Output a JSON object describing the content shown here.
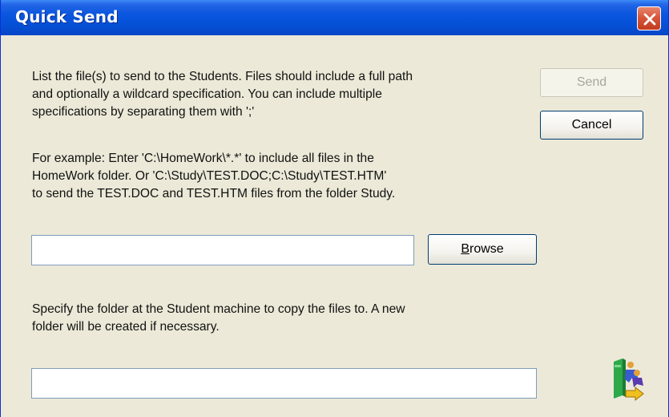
{
  "window": {
    "title": "Quick Send"
  },
  "instructions": {
    "lines": [
      "List the file(s) to send to the Students. Files should include a full path",
      "and optionally a wildcard specification. You can include multiple",
      "specifications by separating them with ';'"
    ]
  },
  "example": {
    "lines": [
      "For example: Enter 'C:\\HomeWork\\*.*' to include all files in the",
      "HomeWork folder. Or 'C:\\Study\\TEST.DOC;C:\\Study\\TEST.HTM'",
      "to send the TEST.DOC and TEST.HTM files from the folder Study."
    ]
  },
  "files_input": {
    "value": ""
  },
  "browse_button": {
    "label_prefix": "",
    "label_accel": "B",
    "label_rest": "rowse"
  },
  "send_button": {
    "label": "Send",
    "enabled": false
  },
  "cancel_button": {
    "label": "Cancel"
  },
  "folder_instructions": {
    "lines": [
      "Specify the folder at the Student machine to copy the files to. A new",
      "folder will be created if necessary."
    ]
  },
  "folder_input": {
    "value": ""
  },
  "icons": {
    "close": "close-icon",
    "app": "quick-send-icon"
  }
}
